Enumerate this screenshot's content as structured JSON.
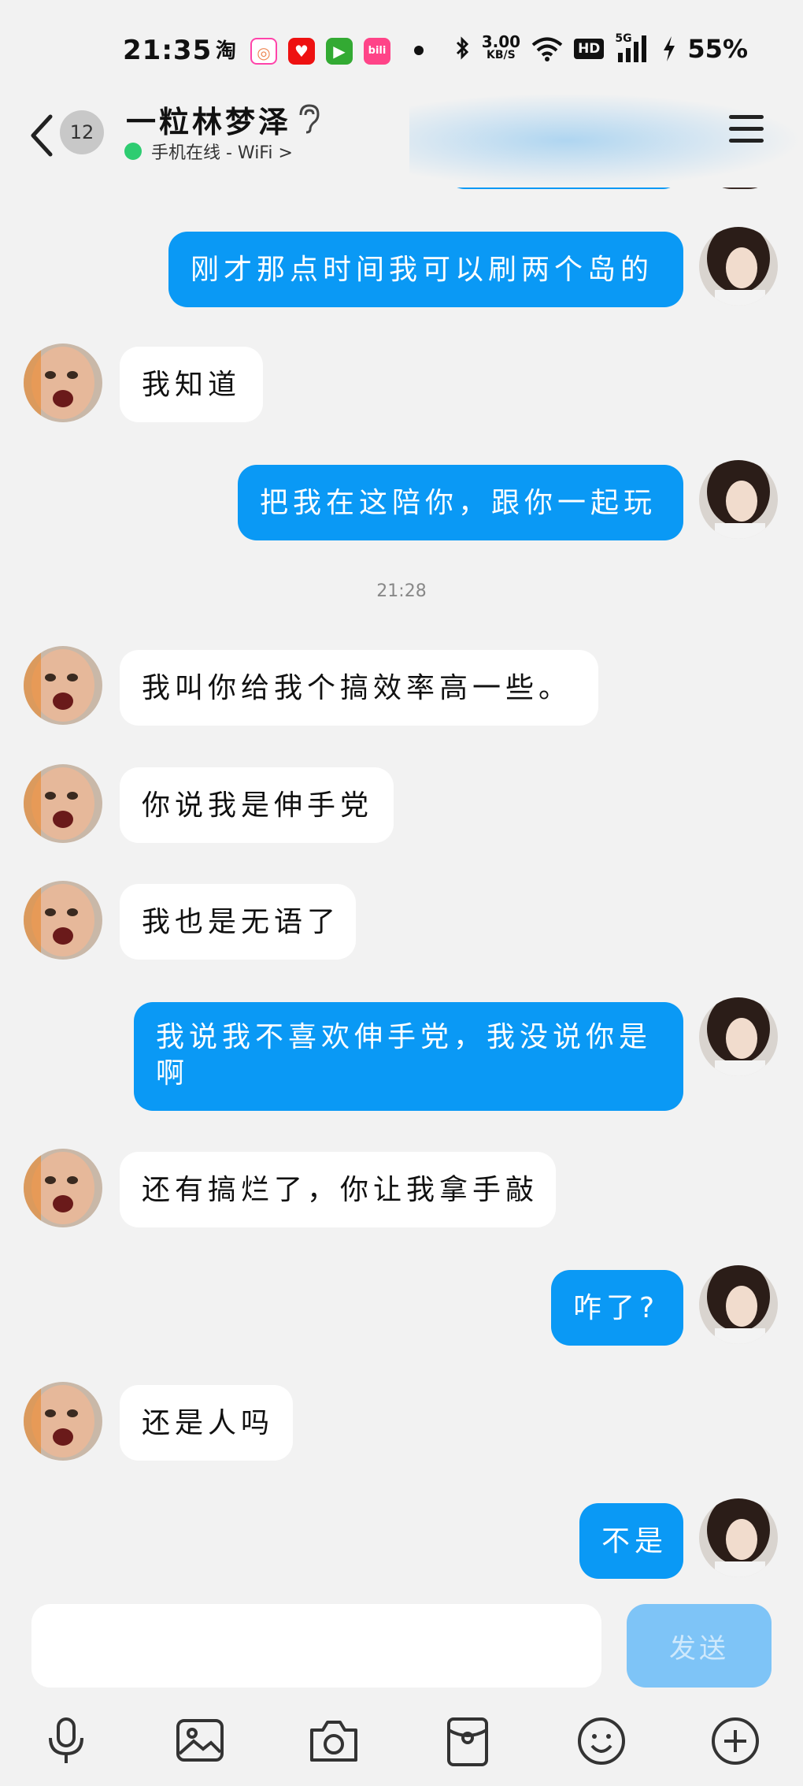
{
  "status_bar": {
    "time": "21:35",
    "apps": [
      "淘",
      "◎",
      "♥",
      "▶",
      "bili"
    ],
    "speed_value": "3.00",
    "speed_unit": "KB/S",
    "hd": "HD",
    "network": "5G",
    "battery": "55%"
  },
  "header": {
    "unread_count": "12",
    "contact_name": "一粒林梦泽",
    "online_status": "手机在线 - WiFi >"
  },
  "messages": [
    {
      "side": "out",
      "text": "刚才那点时间我可以刷两个岛的"
    },
    {
      "side": "in",
      "text": "我知道"
    },
    {
      "side": "out",
      "text": "把我在这陪你，跟你一起玩"
    },
    {
      "side": "in",
      "text": "我叫你给我个搞效率高一些。"
    },
    {
      "side": "in",
      "text": "你说我是伸手党"
    },
    {
      "side": "in",
      "text": "我也是无语了"
    },
    {
      "side": "out",
      "text_line1": "我说我不喜欢伸手党，我没说你是",
      "text_line2": "啊"
    },
    {
      "side": "in",
      "text": "还有搞烂了，你让我拿手敲"
    },
    {
      "side": "out",
      "text": "咋了?"
    },
    {
      "side": "in",
      "text": "还是人吗"
    },
    {
      "side": "out",
      "text": "不是"
    }
  ],
  "timestamp": "21:28",
  "composer": {
    "placeholder": "",
    "send_label": "发送"
  },
  "toolbar": [
    "mic-icon",
    "image-icon",
    "camera-icon",
    "red-packet-icon",
    "emoji-icon",
    "plus-icon"
  ],
  "colors": {
    "outgoing_bubble": "#0a99f5",
    "incoming_bubble": "#ffffff",
    "background": "#f2f2f2",
    "send_button": "#7ec4f7",
    "online_dot": "#2ecc71"
  }
}
